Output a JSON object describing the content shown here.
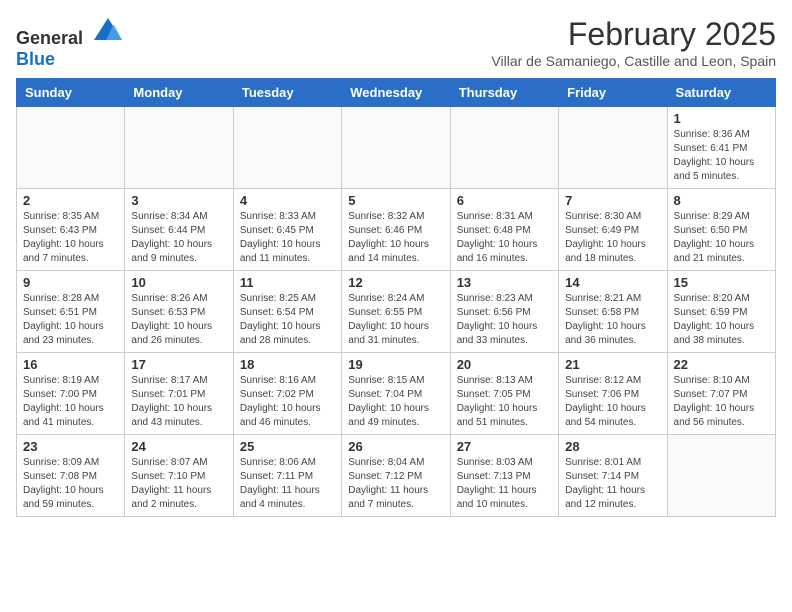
{
  "logo": {
    "general": "General",
    "blue": "Blue"
  },
  "title": "February 2025",
  "subtitle": "Villar de Samaniego, Castille and Leon, Spain",
  "days_of_week": [
    "Sunday",
    "Monday",
    "Tuesday",
    "Wednesday",
    "Thursday",
    "Friday",
    "Saturday"
  ],
  "weeks": [
    [
      {
        "day": "",
        "info": ""
      },
      {
        "day": "",
        "info": ""
      },
      {
        "day": "",
        "info": ""
      },
      {
        "day": "",
        "info": ""
      },
      {
        "day": "",
        "info": ""
      },
      {
        "day": "",
        "info": ""
      },
      {
        "day": "1",
        "info": "Sunrise: 8:36 AM\nSunset: 6:41 PM\nDaylight: 10 hours and 5 minutes."
      }
    ],
    [
      {
        "day": "2",
        "info": "Sunrise: 8:35 AM\nSunset: 6:43 PM\nDaylight: 10 hours and 7 minutes."
      },
      {
        "day": "3",
        "info": "Sunrise: 8:34 AM\nSunset: 6:44 PM\nDaylight: 10 hours and 9 minutes."
      },
      {
        "day": "4",
        "info": "Sunrise: 8:33 AM\nSunset: 6:45 PM\nDaylight: 10 hours and 11 minutes."
      },
      {
        "day": "5",
        "info": "Sunrise: 8:32 AM\nSunset: 6:46 PM\nDaylight: 10 hours and 14 minutes."
      },
      {
        "day": "6",
        "info": "Sunrise: 8:31 AM\nSunset: 6:48 PM\nDaylight: 10 hours and 16 minutes."
      },
      {
        "day": "7",
        "info": "Sunrise: 8:30 AM\nSunset: 6:49 PM\nDaylight: 10 hours and 18 minutes."
      },
      {
        "day": "8",
        "info": "Sunrise: 8:29 AM\nSunset: 6:50 PM\nDaylight: 10 hours and 21 minutes."
      }
    ],
    [
      {
        "day": "9",
        "info": "Sunrise: 8:28 AM\nSunset: 6:51 PM\nDaylight: 10 hours and 23 minutes."
      },
      {
        "day": "10",
        "info": "Sunrise: 8:26 AM\nSunset: 6:53 PM\nDaylight: 10 hours and 26 minutes."
      },
      {
        "day": "11",
        "info": "Sunrise: 8:25 AM\nSunset: 6:54 PM\nDaylight: 10 hours and 28 minutes."
      },
      {
        "day": "12",
        "info": "Sunrise: 8:24 AM\nSunset: 6:55 PM\nDaylight: 10 hours and 31 minutes."
      },
      {
        "day": "13",
        "info": "Sunrise: 8:23 AM\nSunset: 6:56 PM\nDaylight: 10 hours and 33 minutes."
      },
      {
        "day": "14",
        "info": "Sunrise: 8:21 AM\nSunset: 6:58 PM\nDaylight: 10 hours and 36 minutes."
      },
      {
        "day": "15",
        "info": "Sunrise: 8:20 AM\nSunset: 6:59 PM\nDaylight: 10 hours and 38 minutes."
      }
    ],
    [
      {
        "day": "16",
        "info": "Sunrise: 8:19 AM\nSunset: 7:00 PM\nDaylight: 10 hours and 41 minutes."
      },
      {
        "day": "17",
        "info": "Sunrise: 8:17 AM\nSunset: 7:01 PM\nDaylight: 10 hours and 43 minutes."
      },
      {
        "day": "18",
        "info": "Sunrise: 8:16 AM\nSunset: 7:02 PM\nDaylight: 10 hours and 46 minutes."
      },
      {
        "day": "19",
        "info": "Sunrise: 8:15 AM\nSunset: 7:04 PM\nDaylight: 10 hours and 49 minutes."
      },
      {
        "day": "20",
        "info": "Sunrise: 8:13 AM\nSunset: 7:05 PM\nDaylight: 10 hours and 51 minutes."
      },
      {
        "day": "21",
        "info": "Sunrise: 8:12 AM\nSunset: 7:06 PM\nDaylight: 10 hours and 54 minutes."
      },
      {
        "day": "22",
        "info": "Sunrise: 8:10 AM\nSunset: 7:07 PM\nDaylight: 10 hours and 56 minutes."
      }
    ],
    [
      {
        "day": "23",
        "info": "Sunrise: 8:09 AM\nSunset: 7:08 PM\nDaylight: 10 hours and 59 minutes."
      },
      {
        "day": "24",
        "info": "Sunrise: 8:07 AM\nSunset: 7:10 PM\nDaylight: 11 hours and 2 minutes."
      },
      {
        "day": "25",
        "info": "Sunrise: 8:06 AM\nSunset: 7:11 PM\nDaylight: 11 hours and 4 minutes."
      },
      {
        "day": "26",
        "info": "Sunrise: 8:04 AM\nSunset: 7:12 PM\nDaylight: 11 hours and 7 minutes."
      },
      {
        "day": "27",
        "info": "Sunrise: 8:03 AM\nSunset: 7:13 PM\nDaylight: 11 hours and 10 minutes."
      },
      {
        "day": "28",
        "info": "Sunrise: 8:01 AM\nSunset: 7:14 PM\nDaylight: 11 hours and 12 minutes."
      },
      {
        "day": "",
        "info": ""
      }
    ]
  ]
}
